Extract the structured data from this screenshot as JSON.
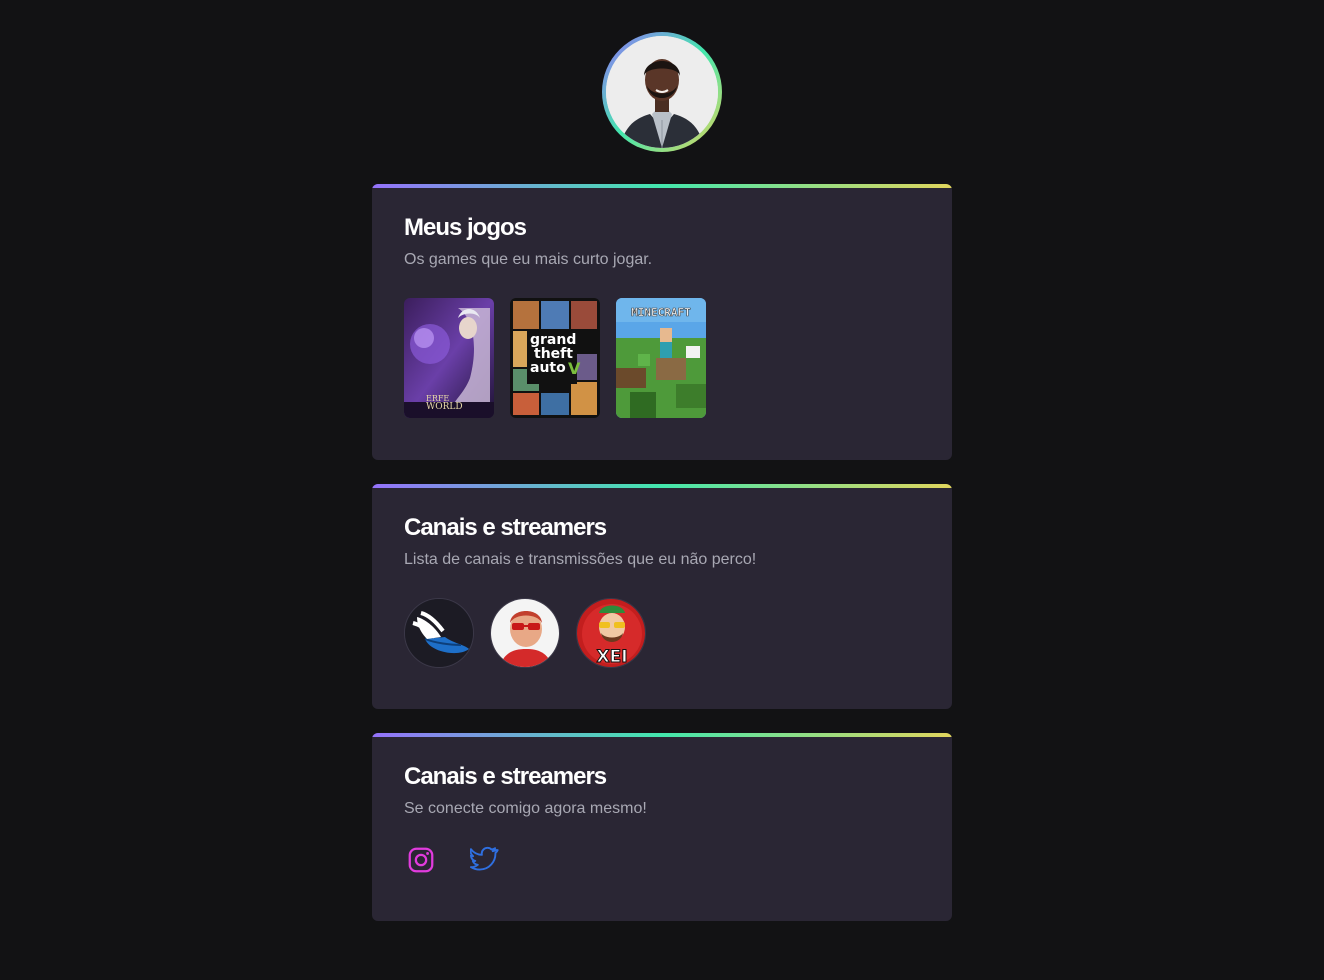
{
  "profile": {
    "avatar_icon": "profile-photo"
  },
  "games_card": {
    "title": "Meus jogos",
    "subtitle": "Os games que eu mais curto jogar.",
    "games": [
      {
        "icon": "perfect-world-cover",
        "logo_line1": "ERFE",
        "logo_line2": "WORLD"
      },
      {
        "icon": "gta-v-cover",
        "logo_line1": "grand",
        "logo_line2": "theft",
        "logo_line3": "auto"
      },
      {
        "icon": "minecraft-cover",
        "logo": "MINECRAFT"
      }
    ]
  },
  "channels_card": {
    "title": "Canais e streamers",
    "subtitle": "Lista de canais e transmissões que eu não perco!",
    "channels": [
      {
        "icon": "winged-shoe-avatar"
      },
      {
        "icon": "streamer-red-glasses-avatar"
      },
      {
        "icon": "xei-avatar",
        "badge": "XEI"
      }
    ]
  },
  "social_card": {
    "title": "Canais e streamers",
    "subtitle": "Se conecte comigo agora mesmo!",
    "links": [
      {
        "icon": "instagram-icon",
        "color": "#e13bdd"
      },
      {
        "icon": "twitter-icon",
        "color": "#2f6fe0"
      }
    ]
  },
  "colors": {
    "background": "#121214",
    "card": "#2a2634",
    "gradient": [
      "#9572fc",
      "#43e7ad",
      "#e1d55d"
    ]
  }
}
